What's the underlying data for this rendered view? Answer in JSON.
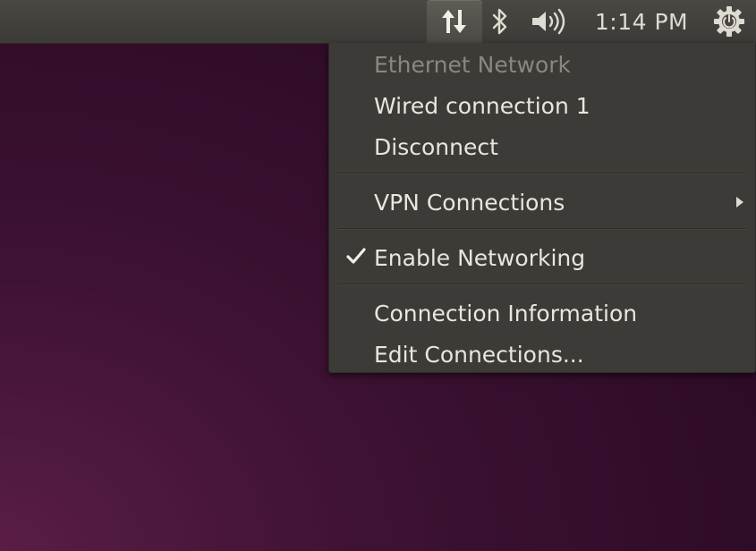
{
  "panel": {
    "network_icon": "network-updown-icon",
    "bluetooth_icon": "bluetooth-icon",
    "sound_icon": "speaker-volume-icon",
    "clock": "1:14 PM",
    "power_icon": "gear-power-icon"
  },
  "menu": {
    "header": "Ethernet Network",
    "wired_connection": "Wired connection 1",
    "disconnect": "Disconnect",
    "vpn": "VPN Connections",
    "enable_networking": "Enable Networking",
    "enable_networking_checked": true,
    "connection_information": "Connection Information",
    "edit_connections": "Edit Connections..."
  },
  "colors": {
    "panel_bg": "#3c3b37",
    "menu_bg": "#3c3b37",
    "text": "#e9e6df",
    "disabled_text": "#8a8781",
    "desktop_bg": "#2c0b26"
  }
}
